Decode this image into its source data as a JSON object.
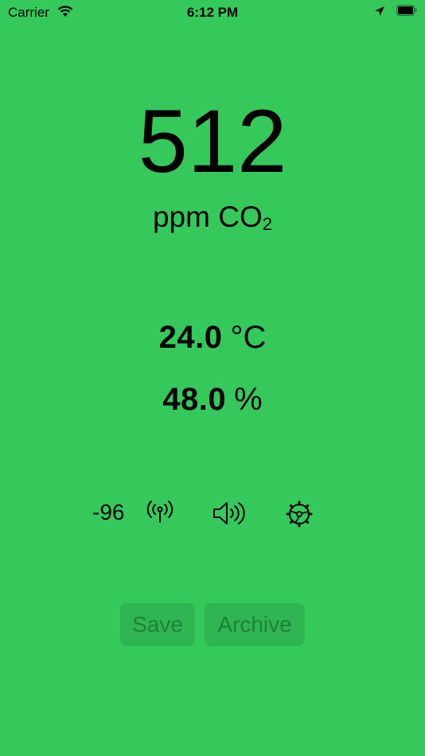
{
  "status_bar": {
    "carrier": "Carrier",
    "time": "6:12 PM"
  },
  "co2": {
    "value": "512",
    "unit": "ppm CO",
    "unit_subscript": "2"
  },
  "temperature": {
    "value": "24.0",
    "unit": "°C"
  },
  "humidity": {
    "value": "48.0",
    "unit": "%"
  },
  "controls": {
    "rssi": "-96",
    "icons": [
      "antenna-icon",
      "speaker-icon",
      "gear-icon"
    ]
  },
  "actions": {
    "save_label": "Save",
    "archive_label": "Archive"
  },
  "colors": {
    "background": "#35c85b",
    "button_bg": "#2ea04c"
  }
}
